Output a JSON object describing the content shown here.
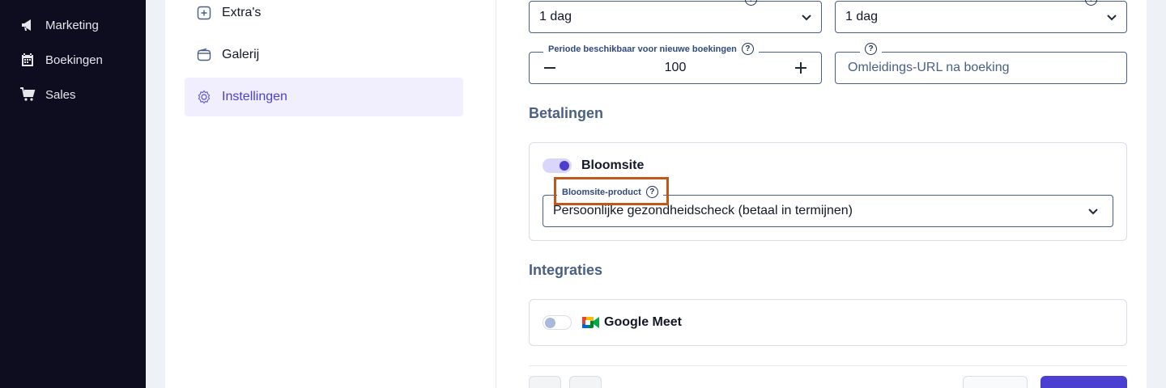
{
  "sidebar": {
    "items": [
      {
        "label": "Marketing",
        "icon": "megaphone-icon"
      },
      {
        "label": "Boekingen",
        "icon": "calendar-icon"
      },
      {
        "label": "Sales",
        "icon": "cart-icon"
      }
    ]
  },
  "menu": {
    "items": [
      {
        "label": "Extra's",
        "icon": "plus-square-icon",
        "active": false
      },
      {
        "label": "Galerij",
        "icon": "wallet-icon",
        "active": false
      },
      {
        "label": "Instellingen",
        "icon": "gear-icon",
        "active": true
      }
    ]
  },
  "form": {
    "min_time_value": "1 dag",
    "min_time_cancel_value": "1 dag",
    "period_label": "Periode beschikbaar voor nieuwe boekingen",
    "period_value": "100",
    "redirect_placeholder": "Omleidings-URL na boeking"
  },
  "payments": {
    "title": "Betalingen",
    "provider_name": "Bloomsite",
    "toggle_on": true,
    "product_label": "Bloomsite-product",
    "product_value": "Persoonlijke gezondheidscheck (betaal in termijnen)"
  },
  "integrations": {
    "title": "Integraties",
    "google_meet_label": "Google Meet",
    "toggle_on": false
  },
  "colors": {
    "accent": "#4b3fd1",
    "highlight": "#c1581b",
    "sidebar_bg": "#0d0d1f"
  }
}
